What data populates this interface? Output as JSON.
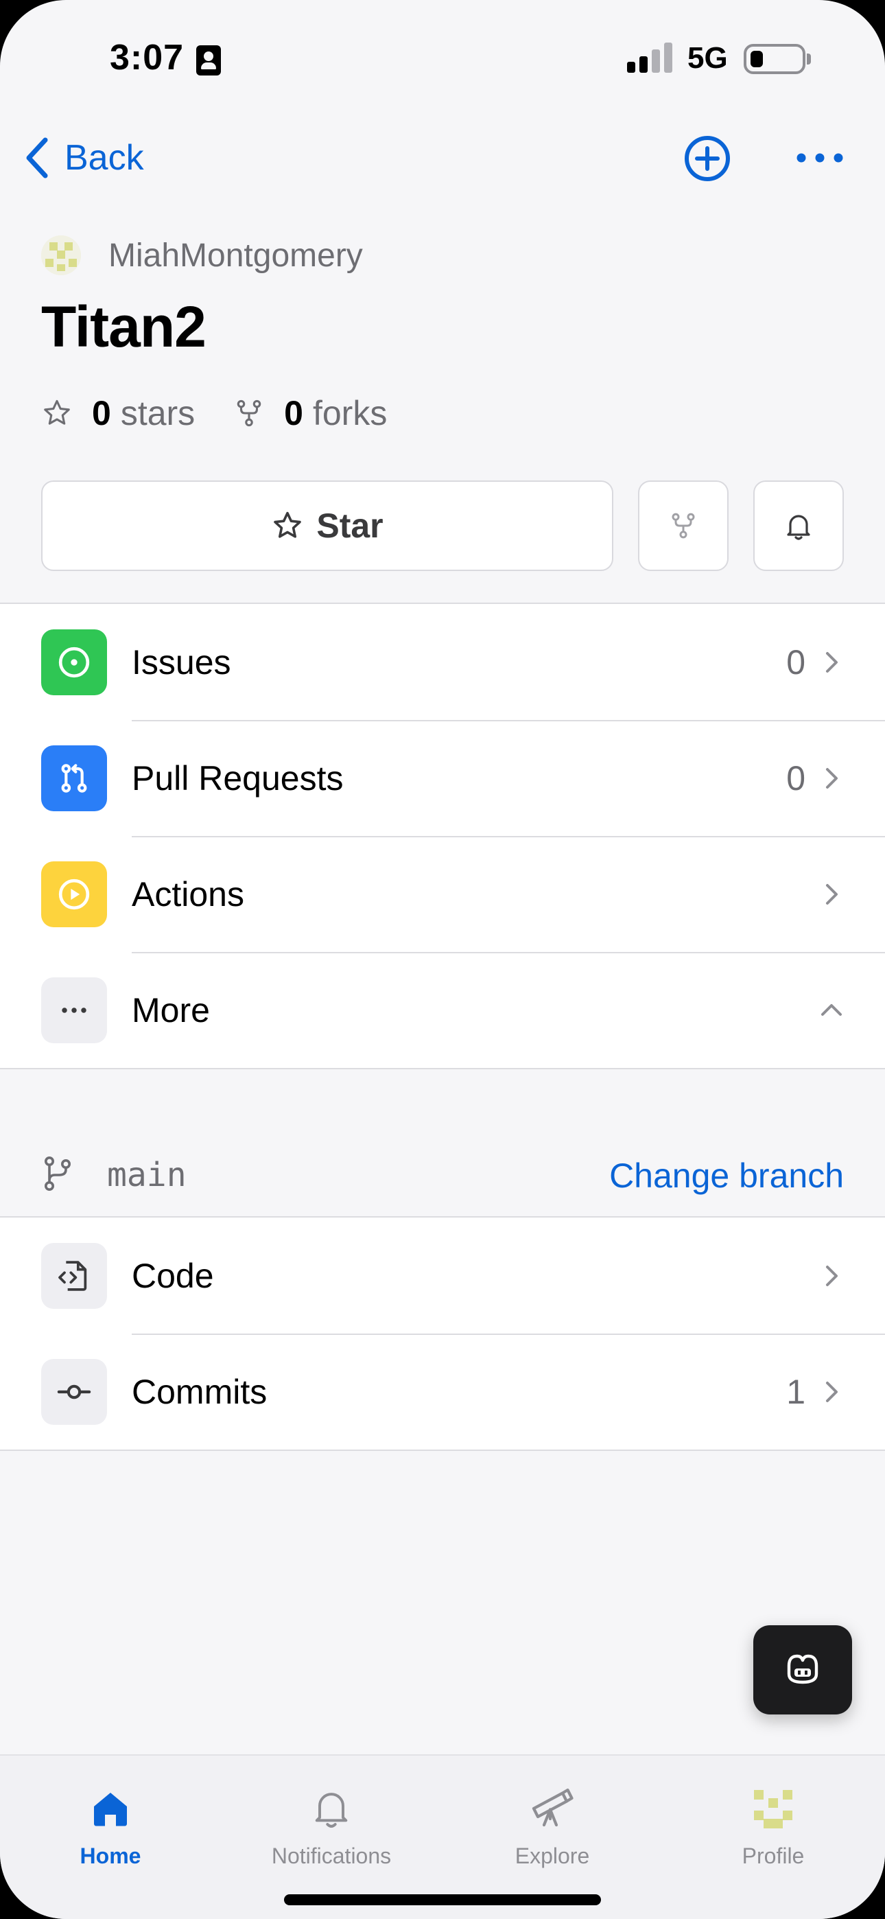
{
  "status_bar": {
    "time": "3:07",
    "network": "5G"
  },
  "nav": {
    "back_label": "Back"
  },
  "repo": {
    "owner": "MiahMontgomery",
    "name": "Titan2",
    "stars_count": "0",
    "stars_label": "stars",
    "forks_count": "0",
    "forks_label": "forks"
  },
  "actions": {
    "star_label": "Star"
  },
  "menu": [
    {
      "label": "Issues",
      "count": "0",
      "color": "#2fc654"
    },
    {
      "label": "Pull Requests",
      "count": "0",
      "color": "#2a7ef7"
    },
    {
      "label": "Actions",
      "count": "",
      "color": "#fdd33d"
    },
    {
      "label": "More",
      "count": "",
      "color": "#eeeef2"
    }
  ],
  "branch": {
    "name": "main",
    "change_label": "Change branch"
  },
  "code_menu": [
    {
      "label": "Code",
      "count": ""
    },
    {
      "label": "Commits",
      "count": "1"
    }
  ],
  "tabs": [
    {
      "label": "Home",
      "icon": "home-icon"
    },
    {
      "label": "Notifications",
      "icon": "bell-icon"
    },
    {
      "label": "Explore",
      "icon": "telescope-icon"
    },
    {
      "label": "Profile",
      "icon": "avatar-icon"
    }
  ],
  "colors": {
    "accent": "#0a64d6",
    "text_secondary": "#6d6d72",
    "separator": "#dcdce0"
  }
}
